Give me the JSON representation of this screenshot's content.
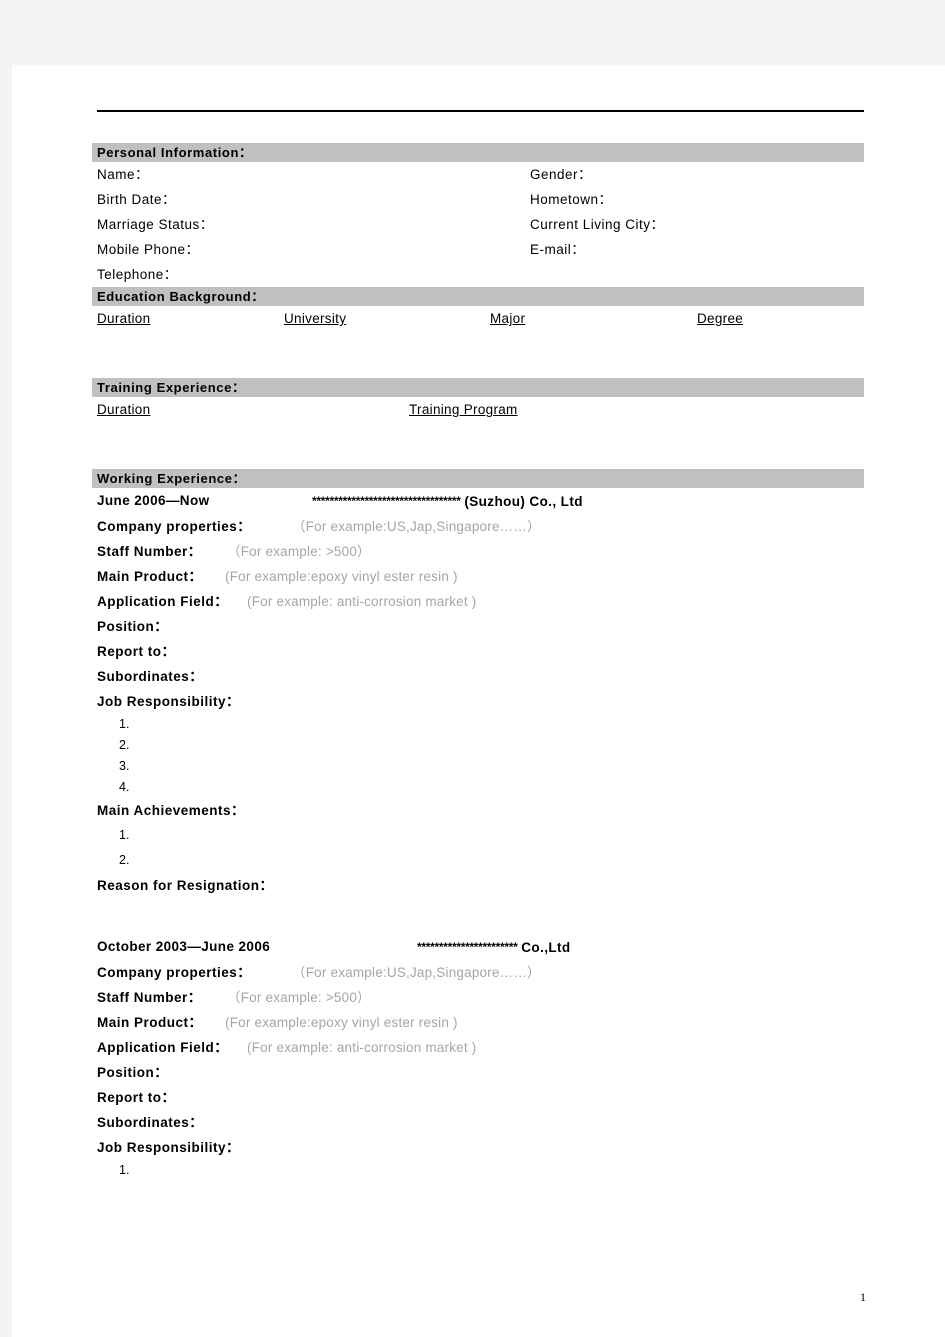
{
  "document": {
    "page_number": "1",
    "colors": {
      "section_bar": "#c0c0c0",
      "placeholder_text": "#a6a6a6",
      "page_background": "#f4f4f4",
      "paper": "#ffffff"
    }
  },
  "personal_information": {
    "heading": "Personal Information：",
    "left_fields": [
      {
        "label": "Name："
      },
      {
        "label": "Birth Date："
      },
      {
        "label": "Marriage Status："
      },
      {
        "label": "Mobile Phone："
      },
      {
        "label": "Telephone："
      }
    ],
    "right_fields": [
      {
        "label": "Gender："
      },
      {
        "label": "Hometown："
      },
      {
        "label": "Current Living City："
      },
      {
        "label": "E-mail："
      }
    ]
  },
  "education_background": {
    "heading": "Education Background：",
    "columns": [
      "Duration",
      "University",
      " Major ",
      "Degree"
    ]
  },
  "training_experience": {
    "heading": "Training Experience：",
    "columns": [
      "Duration",
      "Training Program"
    ]
  },
  "working_experience": {
    "heading": "Working Experience：",
    "jobs": [
      {
        "duration": "June 2006—Now",
        "company_mask": "**********************************",
        "company_suffix": "(Suzhou) Co., Ltd",
        "fields": [
          {
            "label": "Company properties：",
            "value": "（For example:US,Jap,Singapore……）"
          },
          {
            "label": "Staff Number：",
            "value": "（For example: >500）"
          },
          {
            "label": "Main Product：",
            "value": "(For example:epoxy vinyl ester resin )"
          },
          {
            "label": "Application Field：",
            "value": "(For example: anti-corrosion market )"
          },
          {
            "label": "Position：",
            "value": ""
          },
          {
            "label": "Report to：",
            "value": ""
          },
          {
            "label": "Subordinates：",
            "value": ""
          }
        ],
        "job_responsibility_label": "Job Responsibility：",
        "job_responsibility_items": [
          "1.",
          "2.",
          "3.",
          "4."
        ],
        "main_achievements_label": "Main Achievements：",
        "main_achievements_items": [
          "1.",
          "2."
        ],
        "reason_label": "Reason for Resignation："
      },
      {
        "duration": "October 2003—June 2006",
        "company_mask": "***********************",
        "company_suffix": "Co.,Ltd",
        "fields": [
          {
            "label": "Company properties：",
            "value": "（For example:US,Jap,Singapore……）"
          },
          {
            "label": "Staff Number：",
            "value": "（For example: >500）"
          },
          {
            "label": "Main Product：",
            "value": "(For example:epoxy vinyl ester resin )"
          },
          {
            "label": "Application Field：",
            "value": "(For example: anti-corrosion market )"
          },
          {
            "label": "Position：",
            "value": ""
          },
          {
            "label": "Report to：",
            "value": ""
          },
          {
            "label": "Subordinates：",
            "value": ""
          }
        ],
        "job_responsibility_label": "Job Responsibility：",
        "job_responsibility_items": [
          "1."
        ]
      }
    ]
  }
}
